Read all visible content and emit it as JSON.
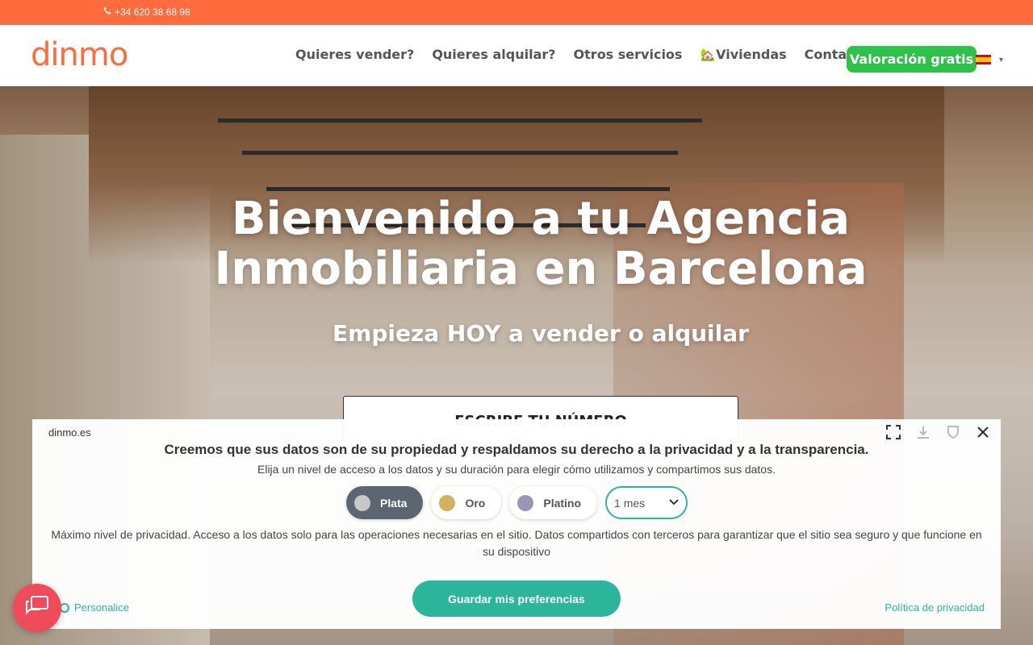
{
  "topbar": {
    "phone": "+34 620 38 68 98"
  },
  "header": {
    "logo": "dinmo",
    "nav": [
      {
        "label": "Quieres vender?"
      },
      {
        "label": "Quieres alquilar?"
      },
      {
        "label": "Otros servicios"
      },
      {
        "label": "Viviendas",
        "icon": "🏡"
      },
      {
        "label": "Contactar"
      }
    ],
    "cta": "Valoración gratis",
    "language": "es"
  },
  "hero": {
    "title": "Bienvenido a tu Agencia Inmobiliaria en Barcelona",
    "subtitle": "Empieza HOY a vender o alquilar",
    "phone_prompt": "ESCRIBE TU NÚMERO"
  },
  "consent": {
    "domain": "dinmo.es",
    "headline": "Creemos que sus datos son de su propiedad y respaldamos su derecho a la privacidad y a la transparencia.",
    "subheadline": "Elija un nivel de acceso a los datos y su duración para elegir cómo utilizamos y compartimos sus datos.",
    "levels": [
      {
        "label": "Plata",
        "color": "#c8c8c8",
        "active": true
      },
      {
        "label": "Oro",
        "color": "#d4b15c",
        "active": false
      },
      {
        "label": "Platino",
        "color": "#9a95b8",
        "active": false
      }
    ],
    "duration": "1 mes",
    "description": "Máximo nivel de privacidad. Acceso a los datos solo para las operaciones necesarias en el sitio. Datos compartidos con terceros para garantizar que el sitio sea seguro y que funcione en su dispositivo",
    "customize": "Personalice",
    "save": "Guardar mis preferencias",
    "policy": "Política de privacidad"
  },
  "colors": {
    "brand": "#ff6b3d",
    "cta": "#2ec24a",
    "consent_accent": "#2bb69c",
    "chat": "#f04b5a"
  }
}
